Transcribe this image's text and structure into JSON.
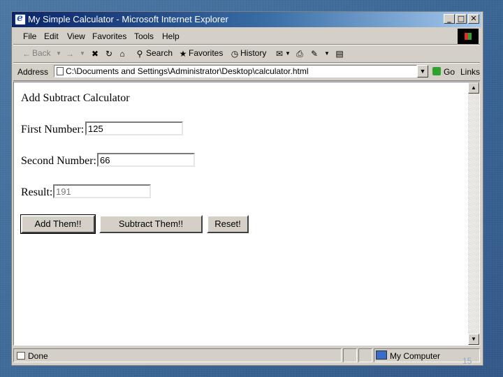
{
  "window": {
    "title": "My Simple Calculator - Microsoft Internet Explorer",
    "controls": {
      "minimize": "_",
      "restore": "□",
      "close": "✕"
    }
  },
  "menu": [
    "File",
    "Edit",
    "View",
    "Favorites",
    "Tools",
    "Help"
  ],
  "toolbar": {
    "back": "Back",
    "search": "Search",
    "favorites": "Favorites",
    "history": "History"
  },
  "address": {
    "label": "Address",
    "value": "C:\\Documents and Settings\\Administrator\\Desktop\\calculator.html",
    "go": "Go",
    "links": "Links"
  },
  "page": {
    "heading": "Add Subtract Calculator",
    "first_label": "First Number:",
    "first_value": "125",
    "second_label": "Second Number:",
    "second_value": "66",
    "result_label": "Result:",
    "result_value": "191",
    "buttons": {
      "add": "Add Them!!",
      "subtract": "Subtract Them!!",
      "reset": "Reset!"
    }
  },
  "status": {
    "text": "Done",
    "zone": "My Computer"
  },
  "slide_number": "15",
  "colors": {
    "slide_bg": "#3f6a98",
    "titlebar_start": "#0a246a",
    "titlebar_end": "#a6caf0",
    "chrome": "#d4d0c8"
  }
}
